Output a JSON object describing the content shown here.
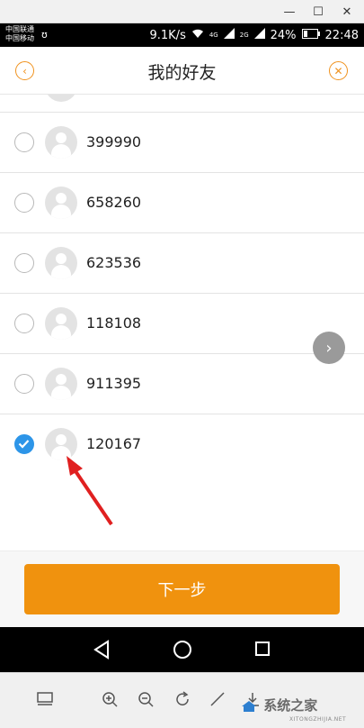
{
  "window": {
    "minimize": "—",
    "maximize": "☐",
    "close": "✕"
  },
  "statusbar": {
    "carrier1": "中国联通",
    "carrier2": "中国移动",
    "speed": "9.1K/s",
    "net1": "4G",
    "net2": "2G",
    "battery": "24%",
    "time": "22:48"
  },
  "header": {
    "title": "我的好友",
    "back_icon": "chevron-left-icon",
    "close_icon": "close-icon"
  },
  "friends": [
    {
      "id": "399990",
      "checked": false
    },
    {
      "id": "658260",
      "checked": false
    },
    {
      "id": "623536",
      "checked": false
    },
    {
      "id": "118108",
      "checked": false
    },
    {
      "id": "911395",
      "checked": false
    },
    {
      "id": "120167",
      "checked": true
    }
  ],
  "next_button": {
    "label": "下一步"
  },
  "colors": {
    "accent": "#f0920e",
    "check": "#2d95e8",
    "annotation_arrow": "#e02020"
  },
  "watermark": {
    "text": "系统之家",
    "sub": "XITONGZHIJIA.NET"
  }
}
